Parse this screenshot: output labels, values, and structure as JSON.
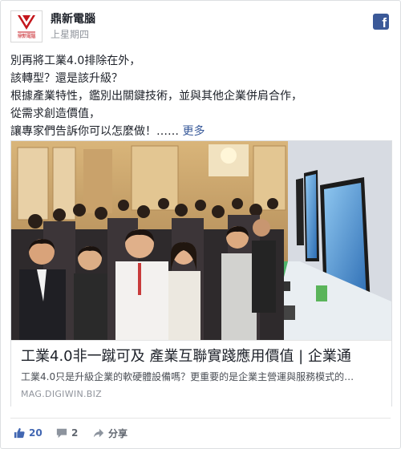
{
  "page": {
    "name": "鼎新電腦",
    "timestamp": "上星期四",
    "logo_caption": "鼎新電腦"
  },
  "post": {
    "lines": [
      "別再將工業4.0排除在外，",
      "該轉型？還是該升級？",
      "根據產業特性，鑑別出關鍵技術，並與其他企業併肩合作，",
      "從需求創造價值，",
      "讓專家們告訴你可以怎麼做！……"
    ],
    "see_more": "更多"
  },
  "link": {
    "title": "工業4.0非一蹴可及 產業互聯實踐應用價值 | 企業通",
    "description": "工業4.0只是升級企業的軟硬體設備嗎？更重要的是企業主營運與服務模式的…",
    "domain": "MAG.DIGIWIN.BIZ"
  },
  "actions": {
    "like_count": "20",
    "comment_count": "2",
    "share_label": "分享"
  },
  "colors": {
    "brand_red": "#c4161c",
    "facebook_blue": "#3b5998",
    "link_blue": "#365899",
    "like_blue": "#4267b2"
  },
  "icons": [
    "facebook-icon",
    "thumbs-up-icon",
    "comment-icon",
    "share-arrow-icon"
  ]
}
